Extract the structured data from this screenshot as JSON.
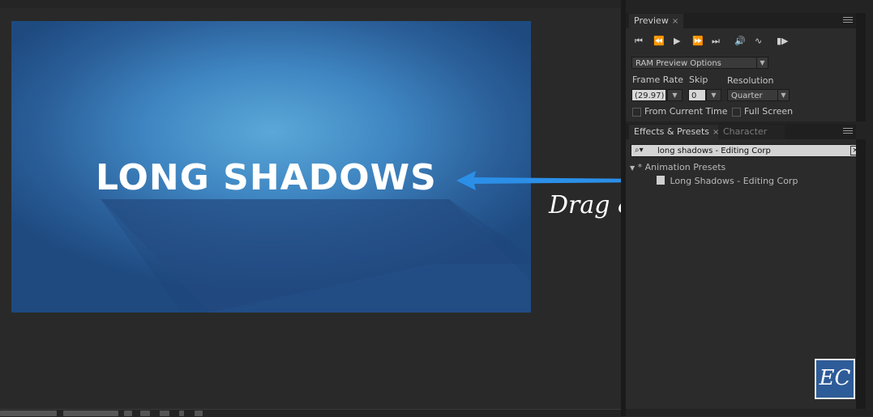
{
  "composition": {
    "title_text": "LONG SHADOWS",
    "annotation": "Drag & Drop",
    "accent_color": "#2b8fe8"
  },
  "preview_panel": {
    "tab_label": "Preview",
    "tab_close": "×",
    "transport_icons": [
      "first-frame-icon",
      "previous-frame-icon",
      "play-icon",
      "next-frame-icon",
      "last-frame-icon",
      "audio-icon",
      "loop-icon",
      "ram-preview-icon"
    ],
    "ram_preview_options": "RAM Preview Options",
    "frame_rate_label": "Frame Rate",
    "frame_rate_value": "(29.97)",
    "skip_label": "Skip",
    "skip_value": "0",
    "resolution_label": "Resolution",
    "resolution_value": "Quarter",
    "from_current_time_label": "From Current Time",
    "full_screen_label": "Full Screen"
  },
  "effects_panel": {
    "tab_label": "Effects & Presets",
    "tab_close": "×",
    "character_tab_label": "Character",
    "search_value": "long shadows - Editing Corp",
    "folder_label": "* Animation Presets",
    "preset_item": "Long Shadows - Editing Corp"
  },
  "logo_text": "EC"
}
